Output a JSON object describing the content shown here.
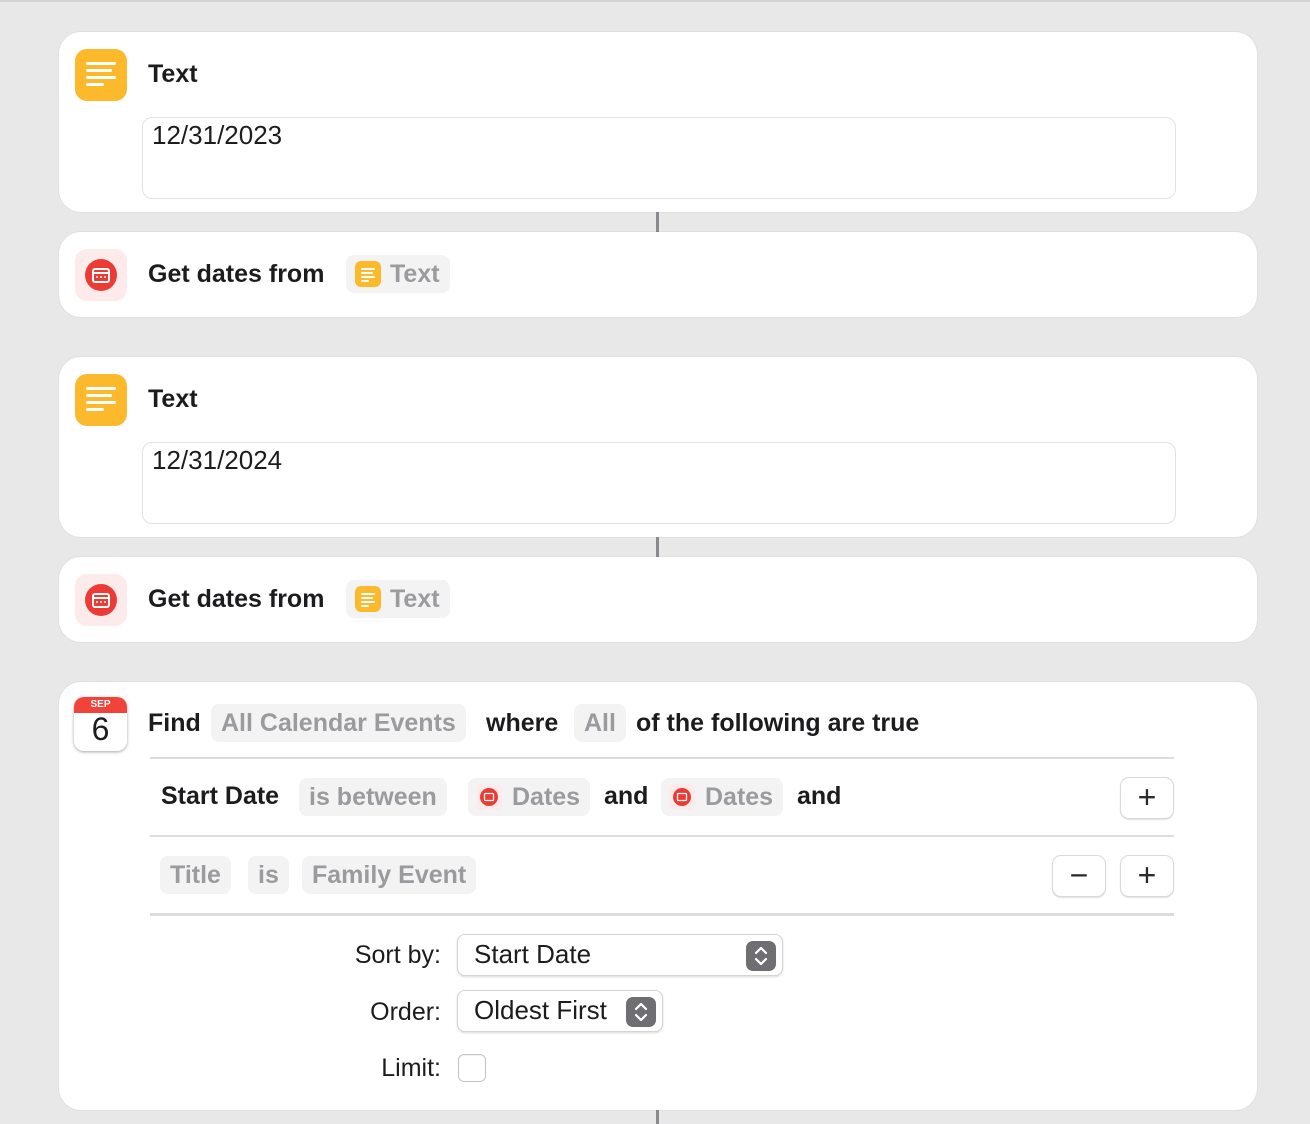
{
  "actions": [
    {
      "type": "text",
      "title": "Text",
      "value": "12/31/2023"
    },
    {
      "type": "get_dates",
      "title": "Get dates from",
      "input_label": "Text"
    },
    {
      "type": "text",
      "title": "Text",
      "value": "12/31/2024"
    },
    {
      "type": "get_dates",
      "title": "Get dates from",
      "input_label": "Text"
    }
  ],
  "find": {
    "icon_month": "SEP",
    "icon_day": "6",
    "find_label": "Find",
    "source": "All Calendar Events",
    "where_label": "where",
    "match": "All",
    "suffix": "of the following are true",
    "filters": [
      {
        "field": "Start Date",
        "operator": "is between",
        "value1": "Dates",
        "and1": "and",
        "value2": "Dates",
        "and2": "and"
      },
      {
        "field": "Title",
        "operator": "is",
        "value": "Family Event"
      }
    ],
    "add_symbol": "+",
    "remove_symbol": "−",
    "sort_label": "Sort by:",
    "sort_value": "Start Date",
    "order_label": "Order:",
    "order_value": "Oldest First",
    "limit_label": "Limit:",
    "limit_checked": false
  },
  "colors": {
    "background": "#e8e8e8",
    "card": "#ffffff",
    "text_icon": "#fdb92c",
    "date_icon_red": "#ec3b34",
    "pill_bg": "#f3f3f3",
    "pill_text": "#9a9a9f"
  },
  "icons": [
    "text-lines-icon",
    "calendar-date-icon",
    "calendar-app-icon",
    "plus-icon",
    "minus-icon",
    "stepper-chevrons-icon"
  ]
}
